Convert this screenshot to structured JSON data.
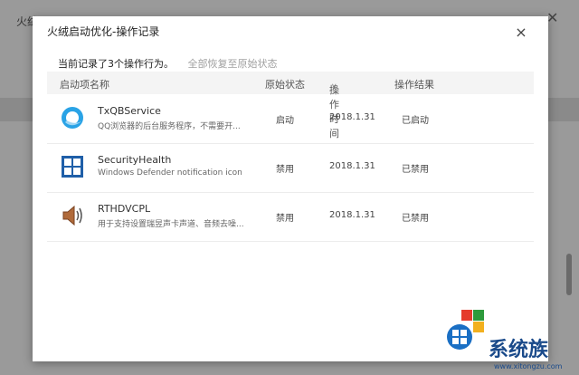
{
  "background_app": {
    "title": "火绒"
  },
  "dialog": {
    "title": "火绒启动优化-操作记录",
    "close_label": "×",
    "summary": {
      "count_text": "当前记录了3个操作行为。",
      "restore_link": "全部恢复至原始状态"
    },
    "columns": {
      "name": "启动项名称",
      "original_state": "原始状态",
      "operation_time": "操作时间",
      "result": "操作结果"
    },
    "rows": [
      {
        "icon": "qq-browser-icon",
        "name": "TxQBService",
        "description": "QQ浏览器的后台服务程序，不需要开...",
        "original_state": "启动",
        "time": "2018.1.31",
        "result": "已启动"
      },
      {
        "icon": "windows-defender-icon",
        "name": "SecurityHealth",
        "description": "Windows Defender notification icon",
        "original_state": "禁用",
        "time": "2018.1.31",
        "result": "已禁用"
      },
      {
        "icon": "speaker-icon",
        "name": "RTHDVCPL",
        "description": "用于支持设置瑞昱声卡声道、音频去噪...",
        "original_state": "禁用",
        "time": "2018.1.31",
        "result": "已禁用"
      }
    ]
  },
  "watermark": {
    "brand": "系统族",
    "url": "www.xitongzu.com"
  },
  "colors": {
    "overlay": "#9a9a9a",
    "header_bg": "#f4f4f4",
    "watermark": "#1a4a8a"
  }
}
